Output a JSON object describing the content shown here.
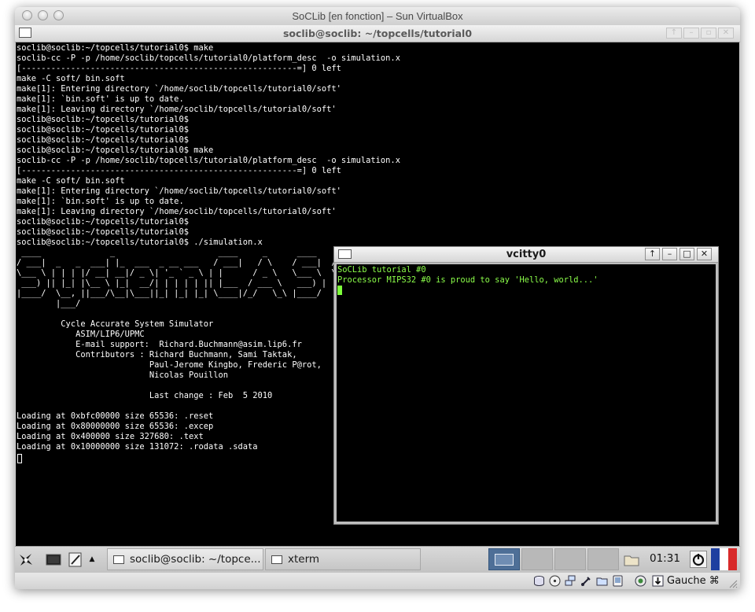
{
  "mac_window": {
    "title": "SoCLib [en fonction] – Sun VirtualBox"
  },
  "terminal": {
    "title": "soclib@soclib: ~/topcells/tutorial0",
    "lines": [
      "soclib@soclib:~/topcells/tutorial0$ make",
      "soclib-cc -P -p /home/soclib/topcells/tutorial0/platform_desc  -o simulation.x",
      "[--------------------------------------------------------=] 0 left",
      "make -C soft/ bin.soft",
      "make[1]: Entering directory `/home/soclib/topcells/tutorial0/soft'",
      "make[1]: `bin.soft' is up to date.",
      "make[1]: Leaving directory `/home/soclib/topcells/tutorial0/soft'",
      "soclib@soclib:~/topcells/tutorial0$",
      "soclib@soclib:~/topcells/tutorial0$",
      "soclib@soclib:~/topcells/tutorial0$",
      "soclib@soclib:~/topcells/tutorial0$ make",
      "soclib-cc -P -p /home/soclib/topcells/tutorial0/platform_desc  -o simulation.x",
      "[--------------------------------------------------------=] 0 left",
      "make -C soft/ bin.soft",
      "make[1]: Entering directory `/home/soclib/topcells/tutorial0/soft'",
      "make[1]: `bin.soft' is up to date.",
      "make[1]: Leaving directory `/home/soclib/topcells/tutorial0/soft'",
      "soclib@soclib:~/topcells/tutorial0$",
      "soclib@soclib:~/topcells/tutorial0$",
      "soclib@soclib:~/topcells/tutorial0$ ./simulation.x",
      " ____              _                     ____     _      ____    ____",
      "/ ___|  _   _  ___| |_  ___  _ __ ___   / ___|   / \\    / ___|  / ___|",
      "\\___ \\ | | | |/ __| __|/ _ \\| '_ ` _ \\ | |      / _ \\   \\___ \\  \\___ \\",
      " ___) || |_| |\\__ \\ |_|  __/| | | | | || |___  / ___ \\   ___) |  ___) |",
      "|____/  \\__, ||___/\\__|\\___||_| |_| |_| \\____|/_/   \\_\\ |____/  |____/",
      "        |___/",
      "",
      "         Cycle Accurate System Simulator",
      "            ASIM/LIP6/UPMC",
      "            E-mail support:  Richard.Buchmann@asim.lip6.fr",
      "            Contributors : Richard Buchmann, Sami Taktak,",
      "                           Paul-Jerome Kingbo, Frederic P@rot,",
      "                           Nicolas Pouillon",
      "",
      "                           Last change : Feb  5 2010",
      "",
      "Loading at 0xbfc00000 size 65536: .reset",
      "Loading at 0x80000000 size 65536: .excep",
      "Loading at 0x400000 size 327680: .text",
      "Loading at 0x10000000 size 131072: .rodata .sdata"
    ]
  },
  "vcitty": {
    "title": "vcitty0",
    "lines": [
      "SoCLib tutorial #0",
      "Processor MIPS32 #0 is proud to say 'Hello, world...'"
    ]
  },
  "panel": {
    "tasks": [
      {
        "label": "soclib@soclib: ~/topce..."
      },
      {
        "label": "xterm"
      }
    ],
    "clock": "01:31"
  },
  "statusbar": {
    "host_key": "Gauche ⌘"
  },
  "colors": {
    "terminal_bg": "#000000",
    "terminal_fg": "#ffffff",
    "vcitty_fg": "#8cff4a",
    "flag_blue": "#1e3fa0",
    "flag_white": "#ffffff",
    "flag_red": "#d82a2a"
  }
}
